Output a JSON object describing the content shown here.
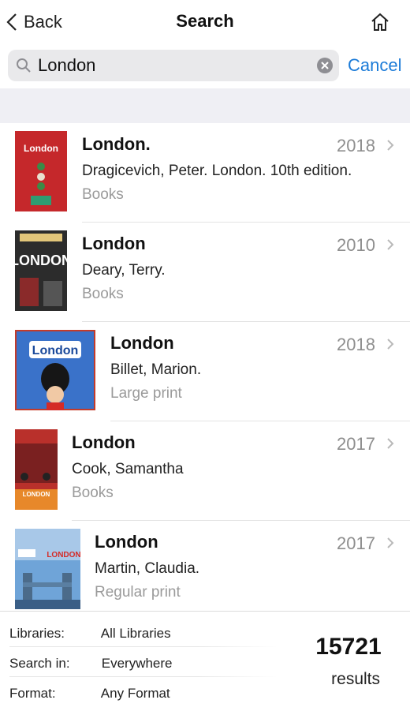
{
  "nav": {
    "back_label": "Back",
    "title": "Search"
  },
  "search": {
    "value": "London",
    "cancel_label": "Cancel"
  },
  "results": [
    {
      "title": "London.",
      "author": "Dragicevich, Peter. London. 10th edition.",
      "format": "Books",
      "year": "2018",
      "cover_text": "London"
    },
    {
      "title": "London",
      "author": "Deary, Terry.",
      "format": "Books",
      "year": "2010",
      "cover_text": "LONDON"
    },
    {
      "title": "London",
      "author": "Billet, Marion.",
      "format": "Large print",
      "year": "2018",
      "cover_text": "London"
    },
    {
      "title": "London",
      "author": "Cook, Samantha",
      "format": "Books",
      "year": "2017",
      "cover_text": "LONDON"
    },
    {
      "title": "London",
      "author": "Martin, Claudia.",
      "format": "Regular print",
      "year": "2017",
      "cover_text": "LONDON"
    }
  ],
  "footer": {
    "libraries_label": "Libraries:",
    "libraries_value": "All Libraries",
    "searchin_label": "Search in:",
    "searchin_value": "Everywhere",
    "format_label": "Format:",
    "format_value": "Any Format",
    "count": "15721",
    "results_label": "results"
  },
  "colors": {
    "accent": "#1b7bd8",
    "muted": "#8e8e8e",
    "group_bg": "#efeff4"
  },
  "icons": {
    "back": "chevron-left-icon",
    "home": "home-icon",
    "search": "magnifier-icon",
    "clear": "clear-icon",
    "row": "chevron-right-icon"
  }
}
